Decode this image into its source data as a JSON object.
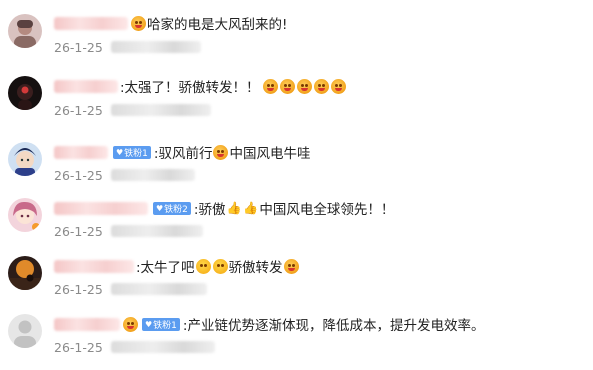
{
  "comments": [
    {
      "text": "哈家的电是大风刮来的!",
      "date": "26-1-25",
      "badge": "",
      "emoji_lead": "crying-emoji",
      "emoji_tail": ""
    },
    {
      "text": ":太强了！骄傲转发！！",
      "date": "26-1-25",
      "badge": "",
      "emoji_lead": "",
      "emoji_tail": "crying-emoji x5"
    },
    {
      "text": ":驭风前行",
      "text2": "中国风电牛哇",
      "date": "26-1-25",
      "badge": "铁粉1",
      "emoji_mid": "crying-emoji"
    },
    {
      "text": ":骄傲",
      "text2": "中国风电全球领先！！",
      "date": "26-1-25",
      "badge": "铁粉2",
      "emoji_mid": "thumbs-up-emoji x2"
    },
    {
      "text": ":太牛了吧",
      "text2": "骄傲转发",
      "date": "26-1-25",
      "badge": "",
      "emoji_mid": "teary-emoji x2"
    },
    {
      "text": ":产业链优势逐渐体现，降低成本，提升发电效率。",
      "date": "26-1-25",
      "badge": "铁粉1",
      "emoji_lead": "crown-emoji"
    }
  ],
  "colors": {
    "badge_blue": "#5b9cf0",
    "date_gray": "#8a8a8a",
    "text_dark": "#222222"
  }
}
